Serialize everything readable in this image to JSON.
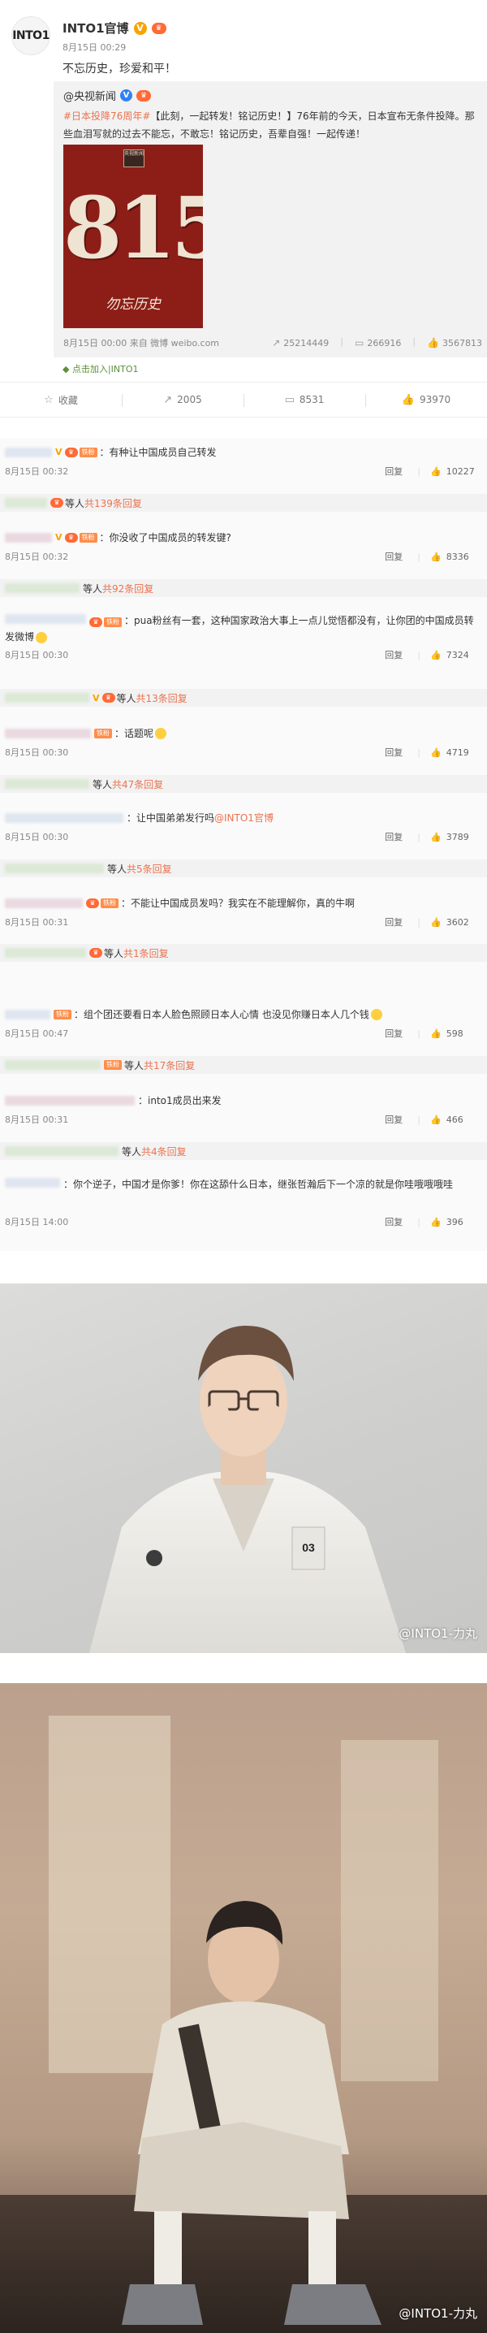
{
  "post": {
    "avatar_text": "INTO1",
    "author": "INTO1官博",
    "v_badge": "V",
    "level_badge": "♛",
    "time": "8月15日 00:29",
    "text": "不忘历史，珍爱和平！",
    "repost": {
      "author": "@央视新闻",
      "v_badge": "V",
      "text_tag": "#日本投降76周年#",
      "text_body": "【此刻，一起转发！铭记历史！】76年前的今天，日本宣布无条件投降。那些血泪写就的过去不能忘，不敢忘！铭记历史，吾辈自强！一起传递！",
      "poster_logo": "央视新闻",
      "poster_big": "815",
      "poster_sub": "勿忘历史",
      "source": "8月15日 00:00 来自 微博 weibo.com",
      "stats": {
        "reposts": "25214449",
        "comments": "266916",
        "likes": "3567813"
      }
    },
    "follow_line": "点击加入|INTO1",
    "actions": {
      "collect": "收藏",
      "repost": "2005",
      "comment": "8531",
      "like": "93970"
    }
  },
  "comments": [
    {
      "text": "：有种让中国成员自己转发",
      "time": "8月15日 00:32",
      "reply": "回复",
      "likes": "10227",
      "sub": {
        "prefix": "等人",
        "more": "共139条回复"
      }
    },
    {
      "text": "：你没收了中国成员的转发键?",
      "time": "8月15日 00:32",
      "reply": "回复",
      "likes": "8336",
      "sub": {
        "prefix": "等人",
        "more": "共92条回复"
      }
    },
    {
      "text": "：pua粉丝有一套，这种国家政治大事上一点儿觉悟都没有，让你团的中国成员转发微博",
      "time": "8月15日 00:30",
      "reply": "回复",
      "likes": "7324",
      "sub": {
        "prefix": "等人",
        "more": "共13条回复"
      }
    },
    {
      "text": "：话题呢",
      "time": "8月15日 00:30",
      "reply": "回复",
      "likes": "4719",
      "sub": {
        "prefix": "等人",
        "more": "共47条回复"
      }
    },
    {
      "text": "：让中国弟弟发行吗",
      "mention": "@INTO1官博",
      "time": "8月15日 00:30",
      "reply": "回复",
      "likes": "3789",
      "sub": {
        "prefix": "等人",
        "more": "共5条回复"
      }
    },
    {
      "text": "：不能让中国成员发吗？我实在不能理解你，真的牛啊",
      "time": "8月15日 00:31",
      "reply": "回复",
      "likes": "3602",
      "sub": {
        "prefix": "等人",
        "more": "共1条回复"
      }
    },
    {
      "text": "：组个团还要看日本人脸色照顾日本人心情 也没见你赚日本人几个钱",
      "time": "8月15日 00:47",
      "reply": "回复",
      "likes": "598",
      "sub": {
        "prefix": "等人",
        "more": "共17条回复"
      }
    },
    {
      "text": "：into1成员出来发",
      "time": "8月15日 00:31",
      "reply": "回复",
      "likes": "466",
      "sub": {
        "prefix": "等人",
        "more": "共4条回复"
      }
    },
    {
      "text": "：你个逆子，中国才是你爹！你在这舔什么日本，继张哲瀚后下一个凉的就是你哇哦哦哦哇",
      "time": "8月15日 14:00",
      "reply": "回复",
      "likes": "396"
    }
  ],
  "photos": [
    {
      "watermark": "@INTO1-力丸"
    },
    {
      "watermark": "@INTO1-力丸"
    }
  ],
  "icons": {
    "collect": "star-icon",
    "repost": "share-icon",
    "comment": "comment-icon",
    "like": "thumbs-up-icon"
  }
}
